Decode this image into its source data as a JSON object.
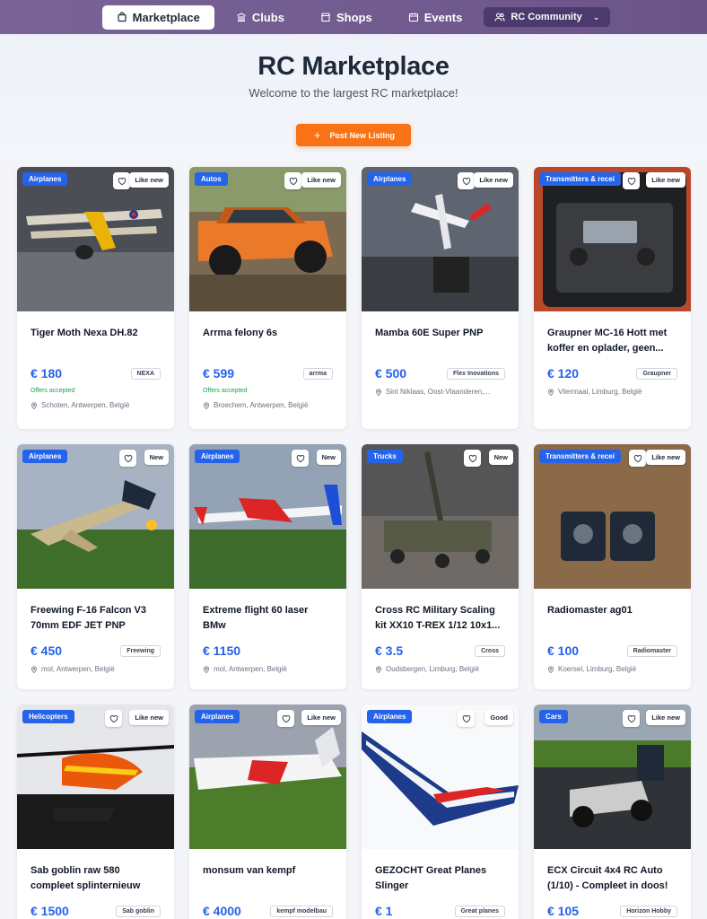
{
  "nav": {
    "items": [
      {
        "label": "Marketplace",
        "icon": "bag-icon",
        "active": true
      },
      {
        "label": "Clubs",
        "icon": "building-icon"
      },
      {
        "label": "Shops",
        "icon": "store-icon"
      },
      {
        "label": "Events",
        "icon": "calendar-icon"
      }
    ],
    "community_label": "RC Community"
  },
  "hero": {
    "title": "RC Marketplace",
    "subtitle": "Welcome to the largest RC marketplace!",
    "post_button": "Post New Listing"
  },
  "colors": {
    "accent": "#2563eb",
    "orange": "#f97316",
    "nav_bg": "#6b5488",
    "offers": "#16a34a"
  },
  "listings": [
    {
      "category": "Airplanes",
      "condition": "Like new",
      "title": "Tiger Moth Nexa DH.82",
      "price": "€ 180",
      "brand": "NEXA",
      "offers": "Offers accepted",
      "location": "Schoten, Antwerpen, België"
    },
    {
      "category": "Autos",
      "condition": "Like new",
      "title": "Arrma felony 6s",
      "price": "€ 599",
      "brand": "arrma",
      "offers": "Offers accepted",
      "location": "Broechem, Antwerpen, België"
    },
    {
      "category": "Airplanes",
      "condition": "Like new",
      "title": "Mamba 60E Super PNP",
      "price": "€ 500",
      "brand": "Flex Inovations",
      "offers": "",
      "location": "Sint Niklaas, Oost-Vlaanderen,..."
    },
    {
      "category": "Transmitters & recei",
      "condition": "Like new",
      "title": "Graupner MC-16 Hott met koffer en oplader, geen...",
      "price": "€ 120",
      "brand": "Graupner",
      "offers": "",
      "location": "Vliermaal, Limburg, België"
    },
    {
      "category": "Airplanes",
      "condition": "New",
      "title": "Freewing F-16 Falcon V3 70mm EDF JET PNP",
      "price": "€ 450",
      "brand": "Freewing",
      "offers": "",
      "location": "mol, Antwerpen, België"
    },
    {
      "category": "Airplanes",
      "condition": "New",
      "title": "Extreme flight 60 laser BMw",
      "price": "€ 1150",
      "brand": "",
      "offers": "",
      "location": "mol, Antwerpen, België"
    },
    {
      "category": "Trucks",
      "condition": "New",
      "title": "Cross RC Military Scaling kit XX10 T-REX 1/12 10x1...",
      "price": "€ 3.5",
      "brand": "Cross",
      "offers": "",
      "location": "Oudsbergen, Limburg, België"
    },
    {
      "category": "Transmitters & recei",
      "condition": "Like new",
      "title": "Radiomaster ag01",
      "price": "€ 100",
      "brand": "Radiomaster",
      "offers": "",
      "location": "Koersel, Limburg, België"
    },
    {
      "category": "Helicopters",
      "condition": "Like new",
      "title": "Sab goblin raw 580 compleet splinternieuw",
      "price": "€ 1500",
      "brand": "Sab goblin",
      "offers": "",
      "location": ""
    },
    {
      "category": "Airplanes",
      "condition": "Like new",
      "title": "monsum van kempf",
      "price": "€ 4000",
      "brand": "kempf modelbau",
      "offers": "",
      "location": ""
    },
    {
      "category": "Airplanes",
      "condition": "Good",
      "title": "GEZOCHT Great Planes Slinger",
      "price": "€ 1",
      "brand": "Great planes",
      "offers": "",
      "location": ""
    },
    {
      "category": "Cars",
      "condition": "Like new",
      "title": "ECX Circuit 4x4 RC Auto (1/10) - Compleet in doos!",
      "price": "€ 105",
      "brand": "Horizon Hobby",
      "offers": "",
      "location": ""
    }
  ]
}
